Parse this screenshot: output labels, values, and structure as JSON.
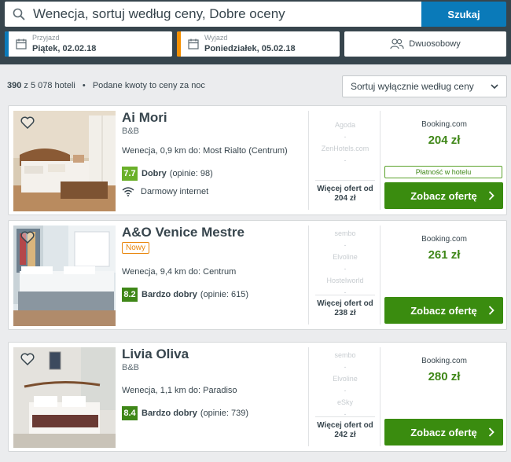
{
  "search": {
    "query": "Wenecja, sortuj według ceny, Dobre oceny",
    "button_label": "Szukaj"
  },
  "dates": {
    "checkin_label": "Przyjazd",
    "checkin_value": "Piątek, 02.02.18",
    "checkout_label": "Wyjazd",
    "checkout_value": "Poniedziałek, 05.02.18"
  },
  "room": {
    "label": "Dwuosobowy"
  },
  "results": {
    "count": "390",
    "total_text": "z 5 078 hoteli",
    "bullet": "•",
    "note": "Podane kwoty to ceny za noc"
  },
  "sort": {
    "selected": "Sortuj wyłącznie według ceny"
  },
  "colors": {
    "header_bg": "#37454d",
    "search_button": "#0a7ab9",
    "checkin_accent": "#0a7ab9",
    "checkout_accent": "#f48f00",
    "cta_green": "#3a8c0f",
    "price_green": "#3f8718",
    "rating_good": "#6ab029",
    "rating_very_good": "#3f8718"
  },
  "hotels": [
    {
      "name": "Ai Mori",
      "type": "B&B",
      "new_badge": "",
      "location": "Wenecja, 0,9 km do: Most Rialto (Centrum)",
      "score": "7.7",
      "rating_word": "Dobry",
      "rating_count": "(opinie: 98)",
      "amenity": "Darmowy internet",
      "partners": [
        "Agoda",
        "-",
        "ZenHotels.com",
        "-"
      ],
      "more_offers_label": "Więcej ofert od",
      "more_offers_price": "204 zł",
      "offer_site": "Booking.com",
      "offer_price": "204 zł",
      "payment_note": "Płatność w hotelu",
      "cta_label": "Zobacz ofertę"
    },
    {
      "name": "A&O Venice Mestre",
      "type": "",
      "new_badge": "Nowy",
      "location": "Wenecja, 9,4 km do: Centrum",
      "score": "8.2",
      "rating_word": "Bardzo dobry",
      "rating_count": "(opinie: 615)",
      "amenity": "",
      "partners": [
        "sembo",
        "-",
        "Elvoline",
        "-",
        "Hostelworld",
        "-"
      ],
      "more_offers_label": "Więcej ofert od",
      "more_offers_price": "238 zł",
      "offer_site": "Booking.com",
      "offer_price": "261 zł",
      "payment_note": "",
      "cta_label": "Zobacz ofertę"
    },
    {
      "name": "Livia Oliva",
      "type": "B&B",
      "new_badge": "",
      "location": "Wenecja, 1,1 km do: Paradiso",
      "score": "8.4",
      "rating_word": "Bardzo dobry",
      "rating_count": "(opinie: 739)",
      "amenity": "",
      "partners": [
        "sembo",
        "-",
        "Elvoline",
        "-",
        "eSky",
        "-"
      ],
      "more_offers_label": "Więcej ofert od",
      "more_offers_price": "242 zł",
      "offer_site": "Booking.com",
      "offer_price": "280 zł",
      "payment_note": "",
      "cta_label": "Zobacz ofertę"
    }
  ]
}
